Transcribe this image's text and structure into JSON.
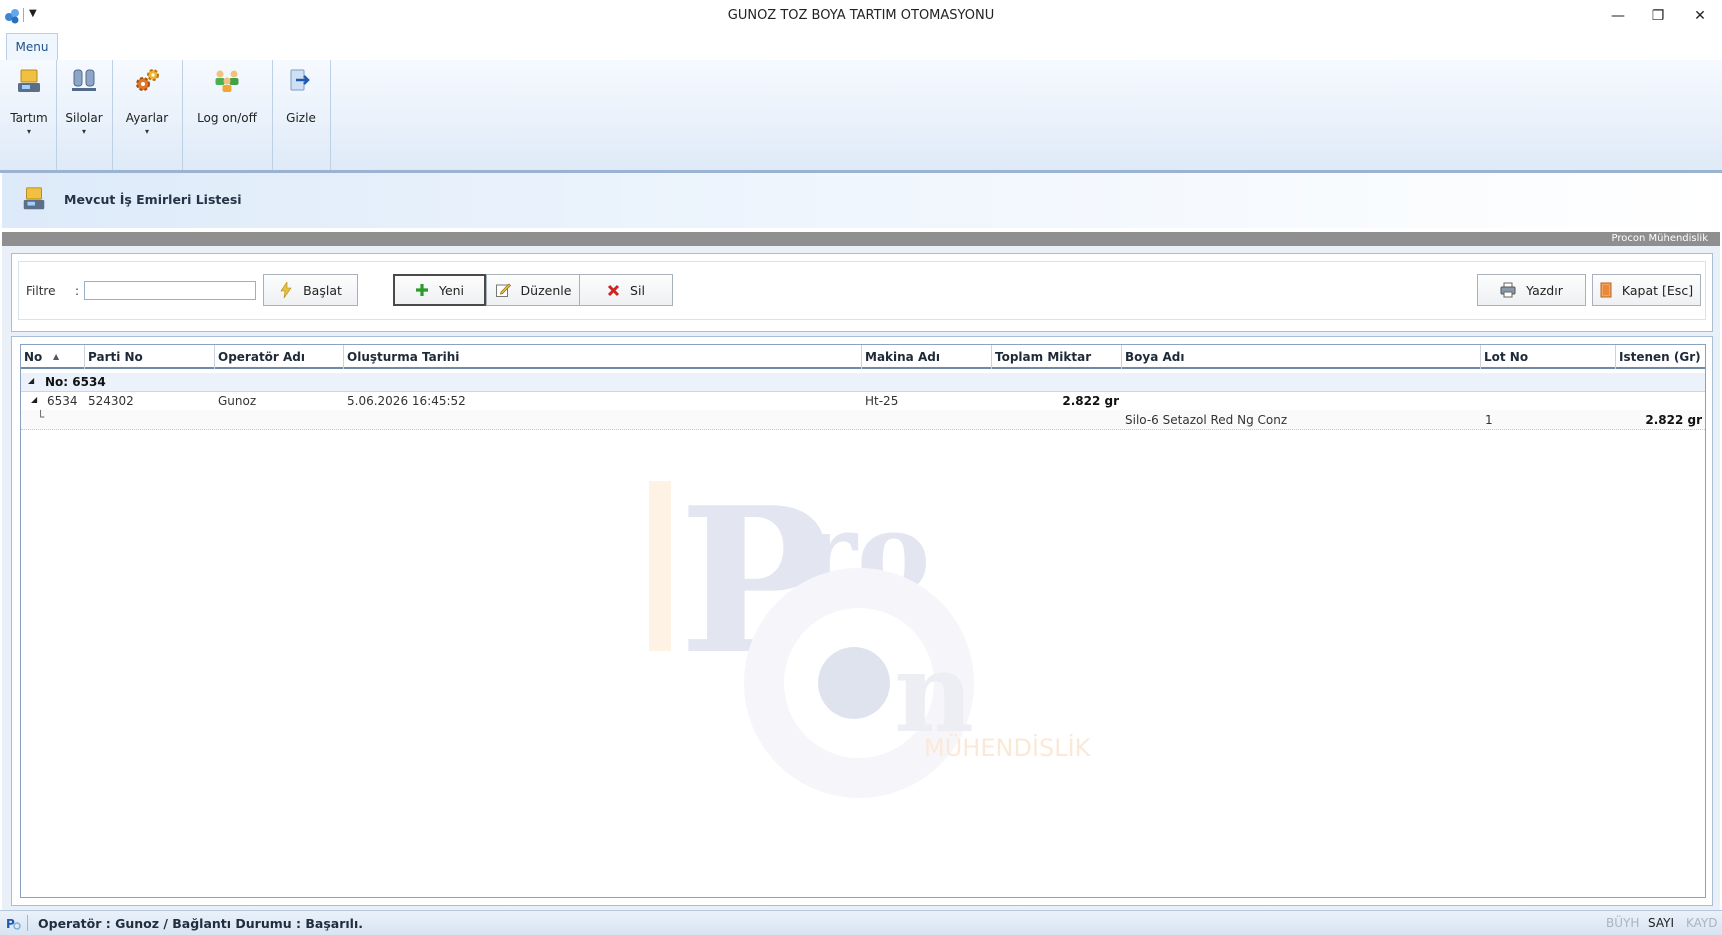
{
  "window": {
    "title": "GUNOZ TOZ BOYA TARTIM OTOMASYONU",
    "minimize_glyph": "—",
    "restore_glyph": "❐",
    "close_glyph": "✕",
    "qat_glyph": "▼"
  },
  "ribbon": {
    "tab_label": "Menu",
    "buttons": [
      {
        "label": "Tartım",
        "icon": "scale-icon",
        "dropdown": true
      },
      {
        "label": "Silolar",
        "icon": "silo-icon",
        "dropdown": true
      },
      {
        "label": "Ayarlar",
        "icon": "gears-icon",
        "dropdown": true
      },
      {
        "label": "Log on/off",
        "icon": "users-icon",
        "dropdown": false
      },
      {
        "label": "Gizle",
        "icon": "hide-arrow-icon",
        "dropdown": false
      }
    ],
    "caret": "▾"
  },
  "header": {
    "title": "Mevcut İş Emirleri Listesi",
    "company": "Procon Mühendislik"
  },
  "filter": {
    "label": "Filtre",
    "colon": ":",
    "value": "",
    "start_label": "Başlat",
    "new_label": "Yeni",
    "edit_label": "Düzenle",
    "delete_label": "Sil",
    "print_label": "Yazdır",
    "close_label": "Kapat [Esc]"
  },
  "grid": {
    "columns": [
      "No",
      "Parti No",
      "Operatör Adı",
      "Oluşturma Tarihi",
      "Makina Adı",
      "Toplam Miktar",
      "Boya Adı",
      "Lot No",
      "Istenen (Gr)"
    ],
    "sort_glyph": "▲",
    "expand_glyph": "◢",
    "child_connector": "└",
    "group_label": "No: 6534",
    "row": {
      "no": "6534",
      "parti_no": "524302",
      "operator": "Gunoz",
      "tarih": "5.06.2026 16:45:52",
      "makina": "Ht-25",
      "toplam": "2.822 gr"
    },
    "detail": {
      "boya": "Silo-6 Setazol Red Ng Conz",
      "lot": "1",
      "istenen": "2.822 gr"
    }
  },
  "status": {
    "text": "Operatör :  Gunoz / Bağlantı Durumu :  Başarılı.",
    "caps": "BÜYH",
    "num": "SAYI",
    "scroll": "KAYD"
  },
  "colors": {
    "accent": "#1e4f8a",
    "delete_red": "#d42020",
    "add_green": "#2e9a2e"
  }
}
